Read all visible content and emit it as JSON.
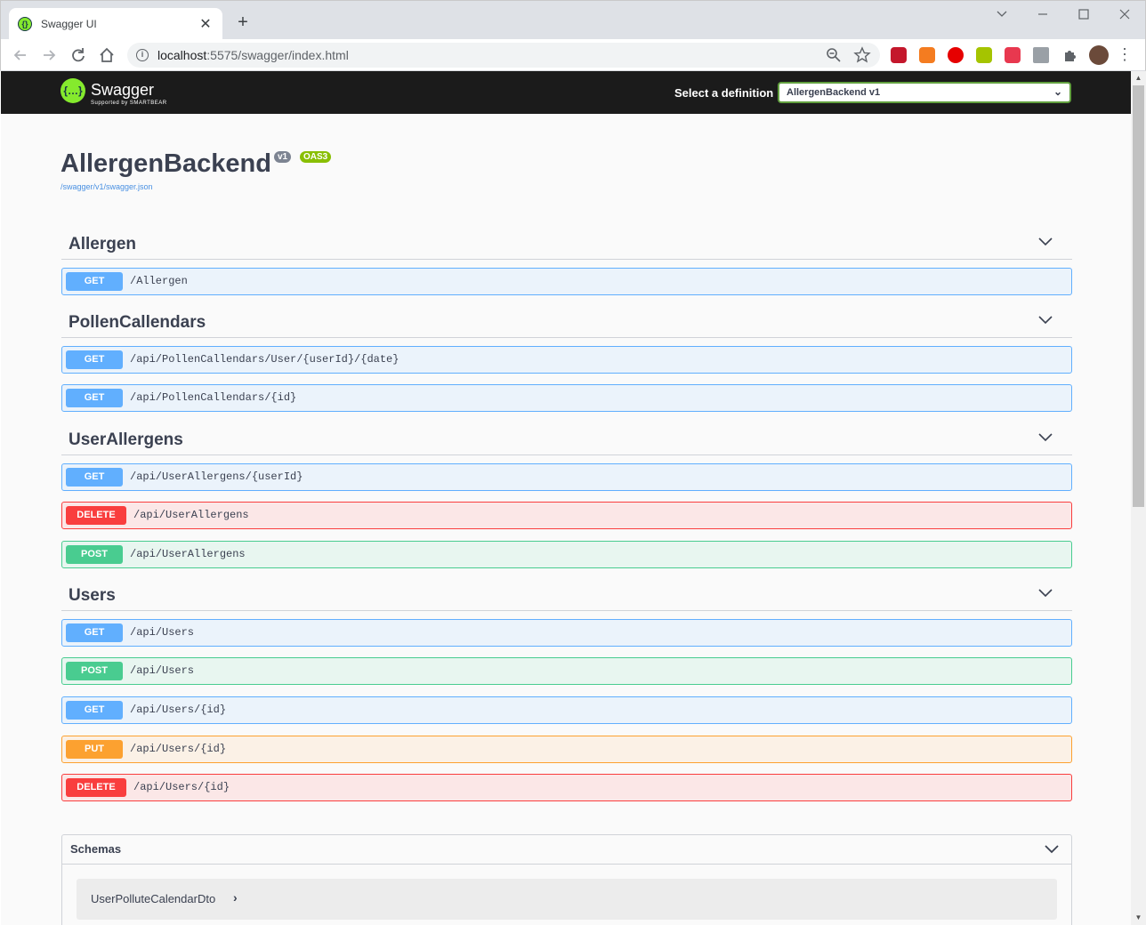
{
  "browser": {
    "tab_title": "Swagger UI",
    "tab_close": "✕",
    "new_tab": "+",
    "url_host": "localhost",
    "url_rest": ":5575/swagger/index.html"
  },
  "swagger": {
    "logo_text": "Swagger",
    "logo_sub": "Supported by SMARTBEAR",
    "select_label": "Select a definition",
    "selected_definition": "AllergenBackend v1"
  },
  "info": {
    "title": "AllergenBackend",
    "version": "v1",
    "oas": "OAS3",
    "spec_url": "/swagger/v1/swagger.json"
  },
  "tags": [
    {
      "name": "Allergen",
      "operations": [
        {
          "method": "GET",
          "path": "/Allergen"
        }
      ]
    },
    {
      "name": "PollenCallendars",
      "operations": [
        {
          "method": "GET",
          "path": "/api/PollenCallendars/User/{userId}/{date}"
        },
        {
          "method": "GET",
          "path": "/api/PollenCallendars/{id}"
        }
      ]
    },
    {
      "name": "UserAllergens",
      "operations": [
        {
          "method": "GET",
          "path": "/api/UserAllergens/{userId}"
        },
        {
          "method": "DELETE",
          "path": "/api/UserAllergens"
        },
        {
          "method": "POST",
          "path": "/api/UserAllergens"
        }
      ]
    },
    {
      "name": "Users",
      "operations": [
        {
          "method": "GET",
          "path": "/api/Users"
        },
        {
          "method": "POST",
          "path": "/api/Users"
        },
        {
          "method": "GET",
          "path": "/api/Users/{id}"
        },
        {
          "method": "PUT",
          "path": "/api/Users/{id}"
        },
        {
          "method": "DELETE",
          "path": "/api/Users/{id}"
        }
      ]
    }
  ],
  "schemas": {
    "title": "Schemas",
    "models": [
      "UserPolluteCalendarDto"
    ]
  },
  "colors": {
    "get": "#61affe",
    "post": "#49cc90",
    "put": "#fca130",
    "delete": "#f93e3e",
    "topbar": "#1b1b1b",
    "swagger_green": "#85ea2d"
  }
}
